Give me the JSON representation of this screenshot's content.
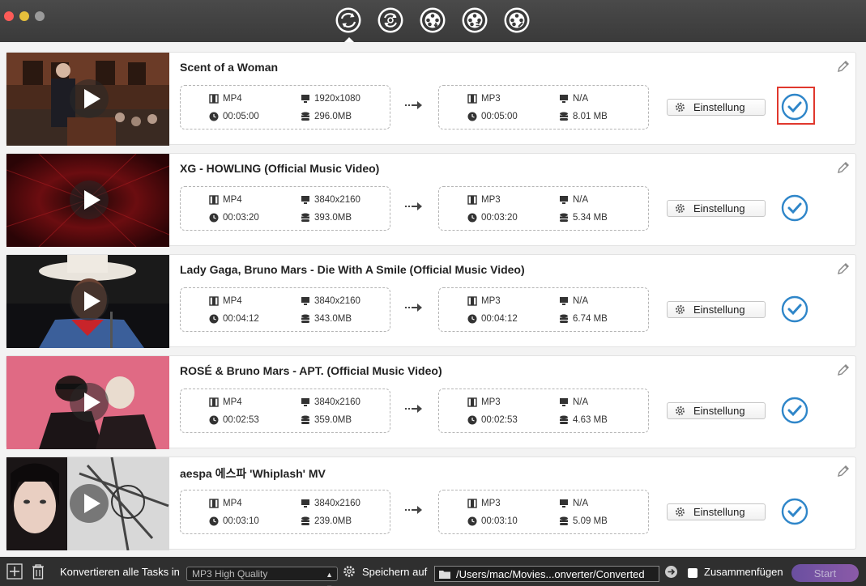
{
  "window": {
    "toolbar_icons": [
      "convert-icon",
      "refresh-icon",
      "film-download-icon",
      "film-convert-icon",
      "film-edit-icon"
    ],
    "active_tab_index": 0
  },
  "videos": [
    {
      "title": "Scent of a Woman",
      "src_format": "MP4",
      "src_resolution": "1920x1080",
      "src_duration": "00:05:00",
      "src_size": "296.0MB",
      "dst_format": "MP3",
      "dst_resolution": "N/A",
      "dst_duration": "00:05:00",
      "dst_size": "8.01 MB",
      "settings_label": "Einstellung",
      "checked": true,
      "highlighted": true
    },
    {
      "title": "XG - HOWLING (Official Music Video)",
      "src_format": "MP4",
      "src_resolution": "3840x2160",
      "src_duration": "00:03:20",
      "src_size": "393.0MB",
      "dst_format": "MP3",
      "dst_resolution": "N/A",
      "dst_duration": "00:03:20",
      "dst_size": "5.34 MB",
      "settings_label": "Einstellung",
      "checked": true,
      "highlighted": false
    },
    {
      "title": "Lady Gaga, Bruno Mars - Die With A Smile (Official Music Video)",
      "src_format": "MP4",
      "src_resolution": "3840x2160",
      "src_duration": "00:04:12",
      "src_size": "343.0MB",
      "dst_format": "MP3",
      "dst_resolution": "N/A",
      "dst_duration": "00:04:12",
      "dst_size": "6.74 MB",
      "settings_label": "Einstellung",
      "checked": true,
      "highlighted": false
    },
    {
      "title": "ROSÉ & Bruno Mars - APT. (Official Music Video)",
      "src_format": "MP4",
      "src_resolution": "3840x2160",
      "src_duration": "00:02:53",
      "src_size": "359.0MB",
      "dst_format": "MP3",
      "dst_resolution": "N/A",
      "dst_duration": "00:02:53",
      "dst_size": "4.63 MB",
      "settings_label": "Einstellung",
      "checked": true,
      "highlighted": false
    },
    {
      "title": "aespa 에스파 'Whiplash' MV",
      "src_format": "MP4",
      "src_resolution": "3840x2160",
      "src_duration": "00:03:10",
      "src_size": "239.0MB",
      "dst_format": "MP3",
      "dst_resolution": "N/A",
      "dst_duration": "00:03:10",
      "dst_size": "5.09 MB",
      "settings_label": "Einstellung",
      "checked": true,
      "highlighted": false
    }
  ],
  "bottom": {
    "convert_all_label": "Konvertieren alle Tasks in",
    "preset_value": "MP3 High Quality",
    "save_label": "Speichern auf",
    "output_path": "/Users/mac/Movies...onverter/Converted",
    "merge_label": "Zusammenfügen",
    "merge_checked": false,
    "start_label": "Start"
  },
  "colors": {
    "accent_blue": "#2f86c9",
    "highlight_red": "#e0382d",
    "start_purple": "#7a55a6"
  }
}
